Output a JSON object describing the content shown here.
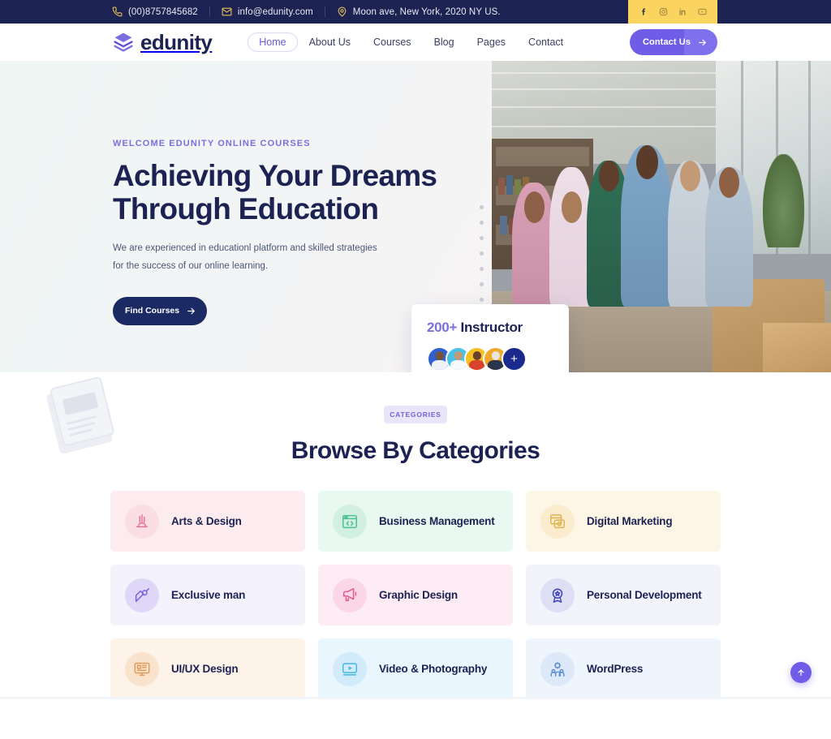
{
  "topbar": {
    "phone": "(00)8757845682",
    "email": "info@edunity.com",
    "address": "Moon ave, New York, 2020 NY US.",
    "social": [
      {
        "name": "facebook-icon",
        "label": "Facebook"
      },
      {
        "name": "instagram-icon",
        "label": "Instagram"
      },
      {
        "name": "linkedin-icon",
        "label": "LinkedIn"
      },
      {
        "name": "youtube-icon",
        "label": "YouTube"
      }
    ],
    "bg_color": "#1c2252",
    "social_bg_color": "#fbd35f"
  },
  "header": {
    "brand": "edunity",
    "nav": [
      {
        "label": "Home",
        "active": true
      },
      {
        "label": "About Us",
        "active": false
      },
      {
        "label": "Courses",
        "active": false
      },
      {
        "label": "Blog",
        "active": false
      },
      {
        "label": "Pages",
        "active": false
      },
      {
        "label": "Contact",
        "active": false
      }
    ],
    "cta_label": "Contact Us",
    "accent_color": "#6f5de8"
  },
  "hero": {
    "eyebrow": "WELCOME EDUNITY ONLINE COURSES",
    "title_line1": "Achieving Your Dreams",
    "title_line2": "Through Education",
    "subtitle_line1": "We are experienced in educationl platform and skilled strategies",
    "subtitle_line2": "for the success of our online learning.",
    "button_label": "Find Courses",
    "instructor_count": "200+",
    "instructor_label": "Instructor",
    "avatar_plus": "+",
    "title_color": "#1c2252",
    "button_color": "#1c2a63"
  },
  "categories": {
    "pill": "CATEGORIES",
    "title": "Browse By Categories",
    "items": [
      {
        "label": "Arts & Design",
        "icon": "palette-icon",
        "card_bg": "#fdecef",
        "circle_bg": "#fbdde4",
        "icon_color": "#e8719a"
      },
      {
        "label": "Business Management",
        "icon": "code-window-icon",
        "card_bg": "#e9f8f1",
        "circle_bg": "#d2f0e2",
        "icon_color": "#4cbf93"
      },
      {
        "label": "Digital Marketing",
        "icon": "ad-board-icon",
        "card_bg": "#fdf6e7",
        "circle_bg": "#fbeccd",
        "icon_color": "#e0b44f"
      },
      {
        "label": "Exclusive man",
        "icon": "pen-design-icon",
        "card_bg": "#f4f2fc",
        "circle_bg": "#ded7f7",
        "icon_color": "#7b5fd8"
      },
      {
        "label": "Graphic Design",
        "icon": "megaphone-icon",
        "card_bg": "#fdecf3",
        "circle_bg": "#fbd6e6",
        "icon_color": "#e0578f"
      },
      {
        "label": "Personal Development",
        "icon": "award-badge-icon",
        "card_bg": "#f3f3fb",
        "circle_bg": "#dedef5",
        "icon_color": "#3c43b5"
      },
      {
        "label": "UI/UX Design",
        "icon": "monitor-ui-icon",
        "card_bg": "#fdf3e9",
        "circle_bg": "#fae3cd",
        "icon_color": "#e09a5a"
      },
      {
        "label": "Video & Photography",
        "icon": "video-play-icon",
        "card_bg": "#e9f6fd",
        "circle_bg": "#d2ebfa",
        "icon_color": "#45b6e8"
      },
      {
        "label": "WordPress",
        "icon": "gear-team-icon",
        "card_bg": "#eef5fd",
        "circle_bg": "#dde9f8",
        "icon_color": "#5b8fd0"
      }
    ]
  },
  "scroll_to_top": {
    "label": "Back to top",
    "icon": "arrow-up-icon",
    "color": "#6f5de8"
  }
}
